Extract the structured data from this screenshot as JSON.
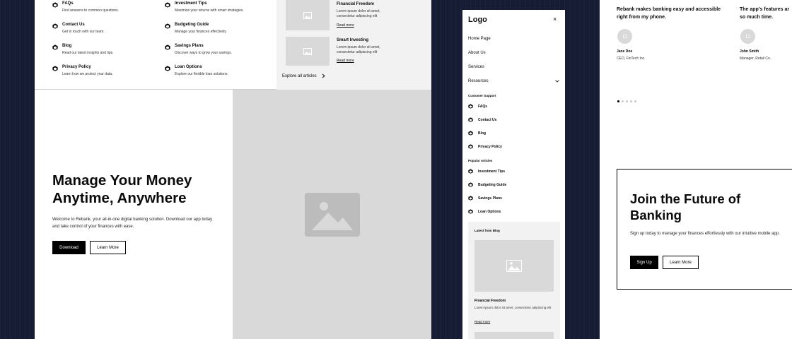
{
  "colors": {
    "background": "#161c33",
    "placeholder": "#d9d9d9",
    "panel": "#f2f2f2",
    "primary": "#000000"
  },
  "desktop": {
    "menu_columns": [
      [
        {
          "title": "FAQs",
          "desc": "Find answers to common questions."
        },
        {
          "title": "Contact Us",
          "desc": "Get in touch with our team."
        },
        {
          "title": "Blog",
          "desc": "Read our latest insights and tips."
        },
        {
          "title": "Privacy Policy",
          "desc": "Learn how we protect your data."
        }
      ],
      [
        {
          "title": "Investment Tips",
          "desc": "Maximize your returns with smart strategies."
        },
        {
          "title": "Budgeting Guide",
          "desc": "Manage your finances effectively."
        },
        {
          "title": "Savings Plans",
          "desc": "Discover ways to grow your savings."
        },
        {
          "title": "Loan Options",
          "desc": "Explore our flexible loan solutions."
        }
      ]
    ],
    "blog_items": [
      {
        "title": "Financial Freedom",
        "desc": "Lorem ipsum dolor sit amet, consectetur adipiscing elit",
        "link": "Read more"
      },
      {
        "title": "Smart Investing",
        "desc": "Lorem ipsum dolor sit amet, consectetur adipiscing elit",
        "link": "Read more"
      }
    ],
    "explore_label": "Explore all articles",
    "hero": {
      "title": "Manage Your Money Anytime, Anywhere",
      "text": "Welcome to Rebank, your all-in-one digital banking solution. Download our app today and take control of your finances with ease.",
      "primary_button": "Download",
      "secondary_button": "Learn More"
    }
  },
  "mobile": {
    "logo": "Logo",
    "close_icon": "×",
    "nav": [
      "Home Page",
      "About Us",
      "Services",
      "Resources"
    ],
    "support_heading": "Customer Support",
    "support_links": [
      "FAQs",
      "Contact Us",
      "Blog",
      "Privacy Policy"
    ],
    "articles_heading": "Popular Articles",
    "article_links": [
      "Investment Tips",
      "Budgeting Guide",
      "Savings Plans",
      "Loan Options"
    ],
    "blog_heading": "Latest from Blog",
    "blog_item": {
      "title": "Financial Freedom",
      "desc": "Lorem ipsum dolor sit amet, consectetur adipiscing elit",
      "link": "Read more"
    }
  },
  "testimonials": {
    "items": [
      {
        "quote_line1": "Rebank makes banking easy and accessible",
        "quote_line2": "right from my phone.",
        "name": "Jane Doe",
        "role": "CEO, FinTech Inc."
      },
      {
        "quote_line1": "The app's features ar",
        "quote_line2": "so much time.",
        "name": "John Smith",
        "role": "Manager, Retail Co."
      }
    ],
    "dot_count": 5,
    "active_dot": 0
  },
  "cta": {
    "title_line1": "Join the Future of",
    "title_line2": "Banking",
    "text": "Sign up today to manage your finances effortlessly with our intuitive mobile app.",
    "primary_button": "Sign Up",
    "secondary_button": "Learn More"
  }
}
